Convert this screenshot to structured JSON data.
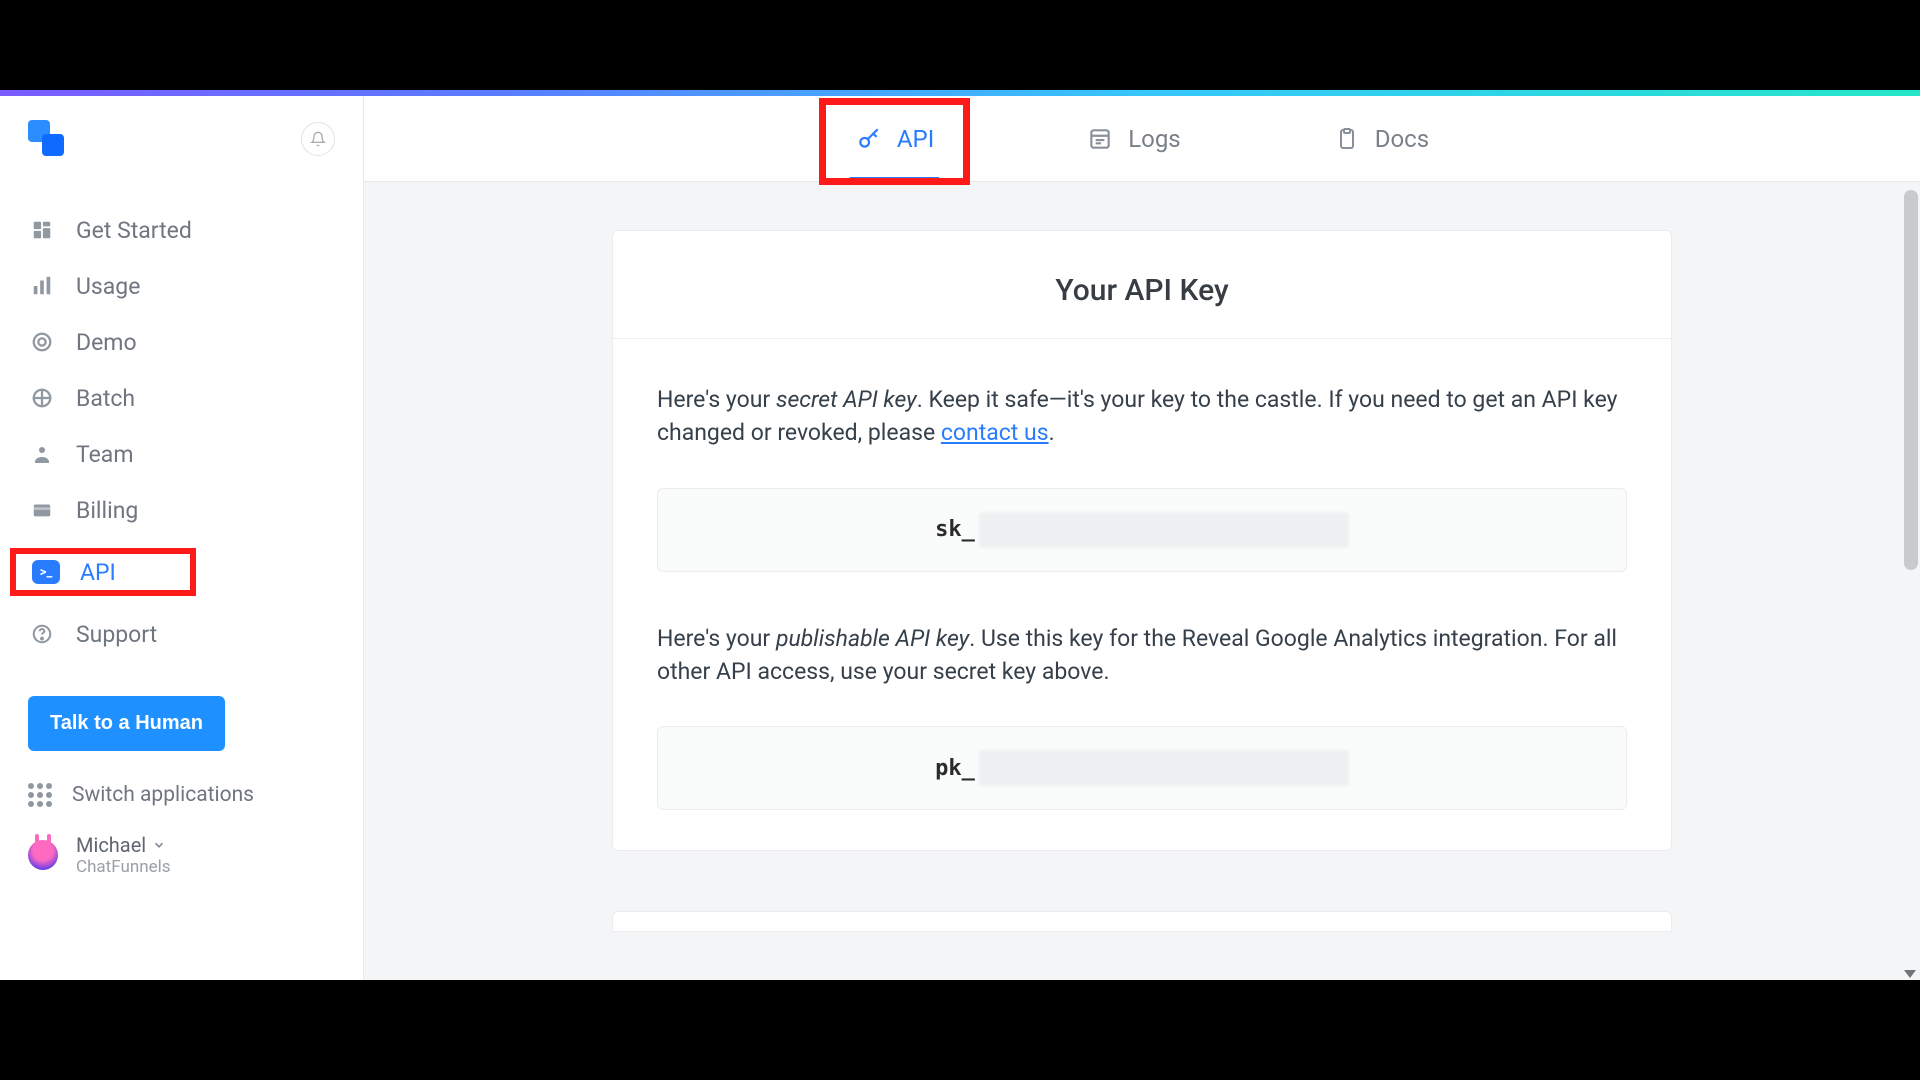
{
  "sidebar": {
    "items": [
      {
        "label": "Get Started",
        "icon": "dashboard-icon"
      },
      {
        "label": "Usage",
        "icon": "bar-chart-icon"
      },
      {
        "label": "Demo",
        "icon": "target-icon"
      },
      {
        "label": "Batch",
        "icon": "grid4-icon"
      },
      {
        "label": "Team",
        "icon": "team-icon"
      },
      {
        "label": "Billing",
        "icon": "billing-icon"
      },
      {
        "label": "API",
        "icon": "terminal-icon",
        "active": true
      },
      {
        "label": "Support",
        "icon": "help-icon"
      }
    ],
    "cta_label": "Talk to a Human",
    "switch_label": "Switch applications",
    "user_name": "Michael",
    "user_org": "ChatFunnels"
  },
  "topbar": {
    "tabs": [
      {
        "label": "API",
        "icon": "key-icon",
        "active": true
      },
      {
        "label": "Logs",
        "icon": "logs-icon"
      },
      {
        "label": "Docs",
        "icon": "docs-icon"
      }
    ]
  },
  "card": {
    "title": "Your API Key",
    "secret_intro_1": "Here's your ",
    "secret_em": "secret API key",
    "secret_intro_2": ". Keep it safe—it's your key to the castle. If you need to get an API key changed or revoked, please ",
    "contact_label": "contact us",
    "secret_key_prefix": "sk_",
    "pub_intro_1": "Here's your ",
    "pub_em": "publishable API key",
    "pub_intro_2": ". Use this key for the Reveal Google Analytics integration. For all other API access, use your secret key above.",
    "pub_key_prefix": "pk_"
  }
}
